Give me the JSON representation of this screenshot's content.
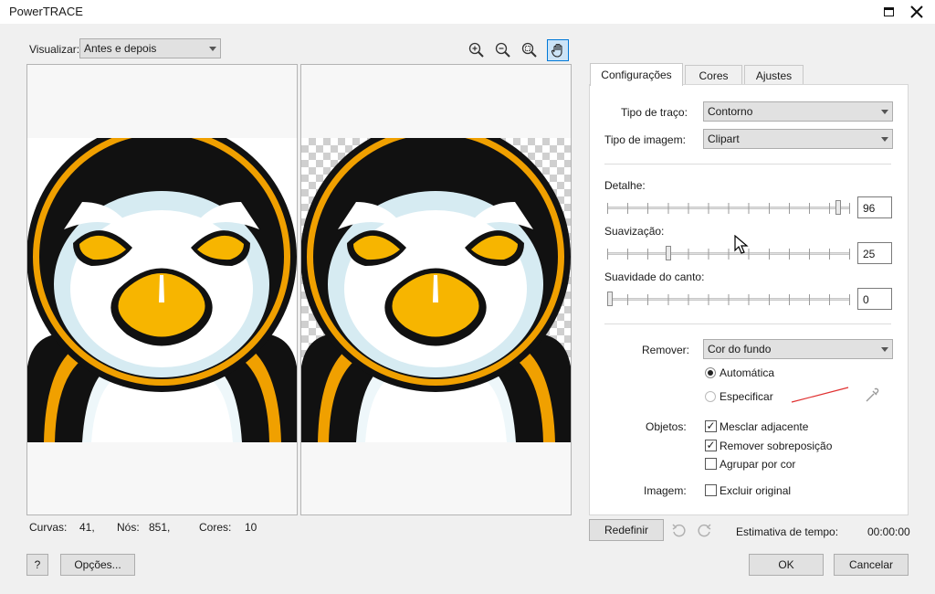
{
  "window": {
    "title": "PowerTRACE"
  },
  "view": {
    "label": "Visualizar:",
    "value": "Antes e depois"
  },
  "stats": {
    "curves_label": "Curvas:",
    "curves": "41,",
    "nodes_label": "Nós:",
    "nodes": "851,",
    "colors_label": "Cores:",
    "colors": "10"
  },
  "tabs": [
    "Configurações",
    "Cores",
    "Ajustes"
  ],
  "settings": {
    "trace_type_label": "Tipo de traço:",
    "trace_type": "Contorno",
    "image_type_label": "Tipo de imagem:",
    "image_type": "Clipart",
    "detail_label": "Detalhe:",
    "detail": "96",
    "smoothing_label": "Suavização:",
    "smoothing": "25",
    "corner_label": "Suavidade do canto:",
    "corner": "0",
    "remove_label": "Remover:",
    "remove": "Cor do fundo",
    "auto_label": "Automática",
    "specify_label": "Especificar",
    "objects_label": "Objetos:",
    "merge_label": "Mesclar adjacente",
    "overlap_label": "Remover sobreposição",
    "group_label": "Agrupar por cor",
    "image_label": "Imagem:",
    "delete_label": "Excluir original"
  },
  "footer": {
    "reset": "Redefinir",
    "time_label": "Estimativa de tempo:",
    "time": "00:00:00",
    "help": "?",
    "options": "Opções...",
    "ok": "OK",
    "cancel": "Cancelar"
  },
  "colors": {
    "accent": "#0078d7",
    "penguin_orange": "#f0a000",
    "beak_yellow": "#f7b500",
    "ice_blue": "#d6ebf2",
    "dark": "#1a1a1a",
    "swatch_red": "#e03030"
  }
}
